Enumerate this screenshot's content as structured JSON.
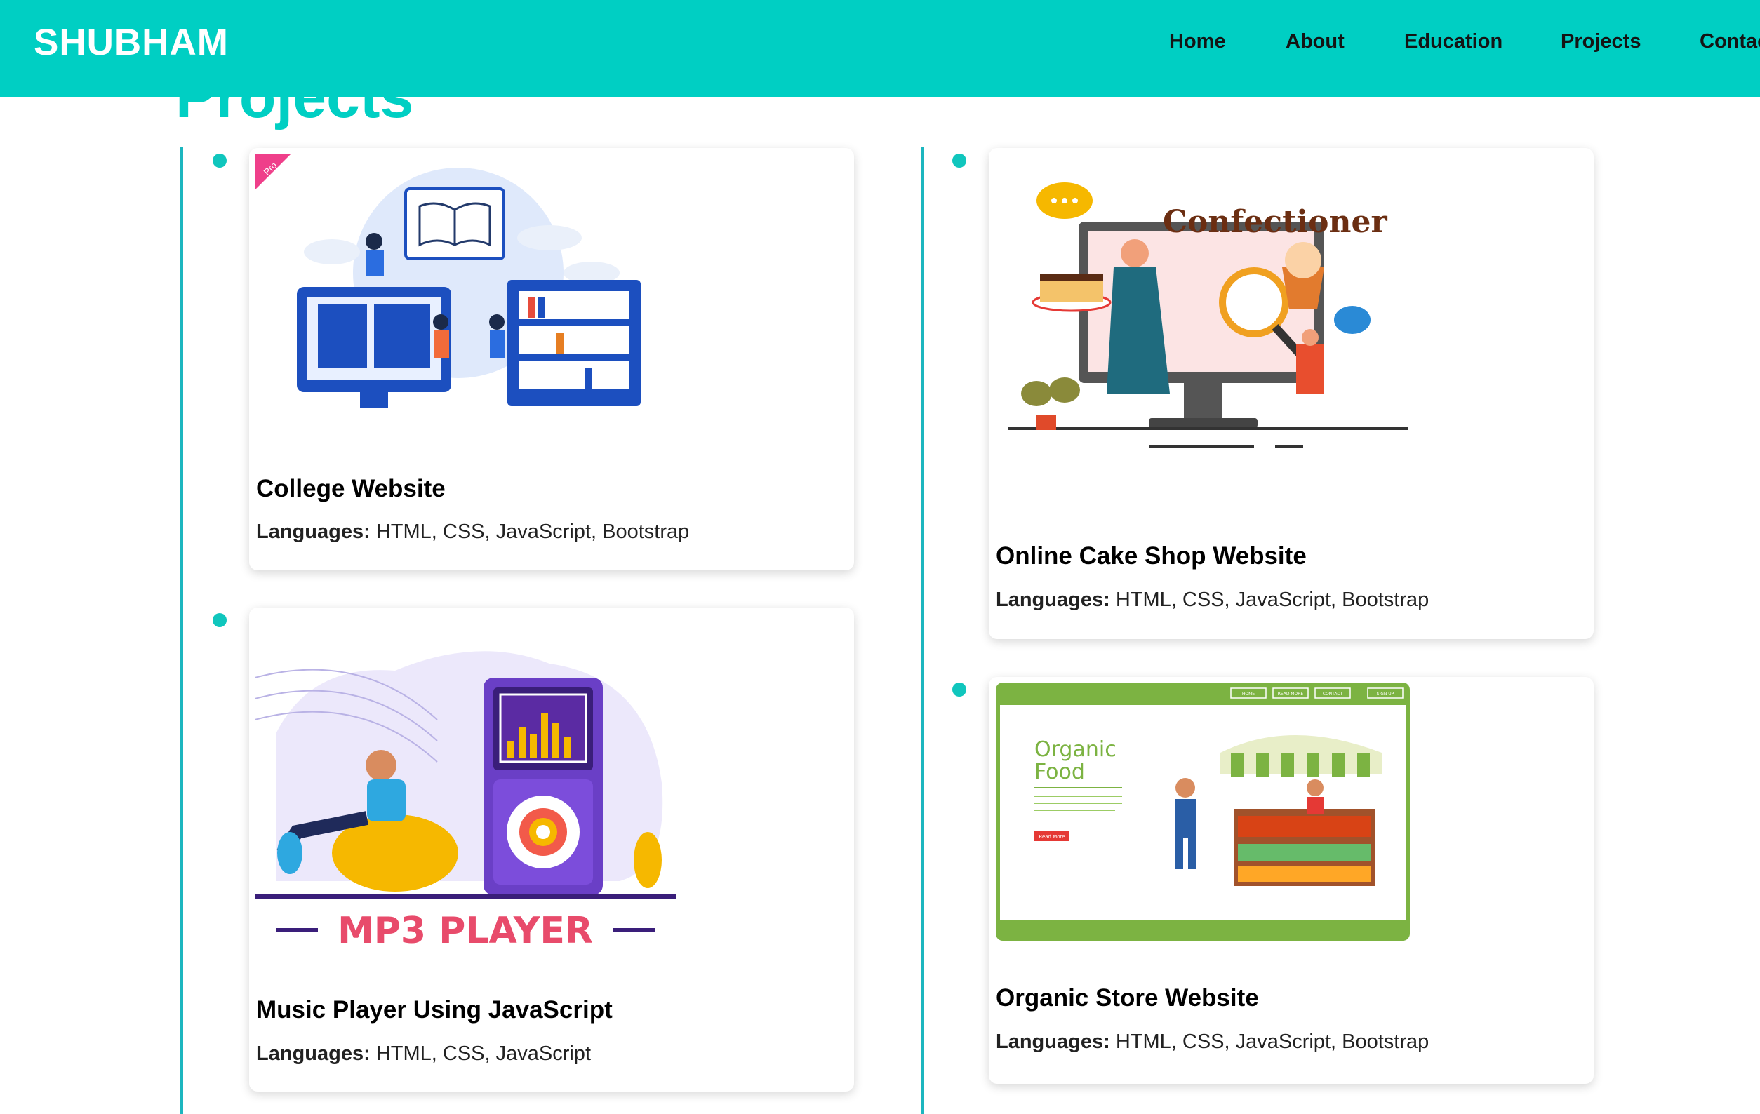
{
  "navbar": {
    "brand": "SHUBHAM",
    "links": [
      "Home",
      "About",
      "Education",
      "Projects",
      "Contac"
    ]
  },
  "section": {
    "title": "Projects"
  },
  "projects": [
    {
      "title": "College Website",
      "languages_label": "Languages:",
      "languages": "HTML, CSS, JavaScript, Bootstrap",
      "badge": "Pro",
      "image": "college-illustration"
    },
    {
      "title": "Online Cake Shop Website",
      "languages_label": "Languages:",
      "languages": "HTML, CSS, JavaScript, Bootstrap",
      "image_text": "Confectioner",
      "image": "confectioner-illustration"
    },
    {
      "title": "Music Player Using JavaScript",
      "languages_label": "Languages:",
      "languages": "HTML, CSS, JavaScript",
      "image_text": "MP3 PLAYER",
      "image": "mp3-player-illustration"
    },
    {
      "title": "Organic Store Website",
      "languages_label": "Languages:",
      "languages": "HTML, CSS, JavaScript, Bootstrap",
      "image_text": "Organic Food",
      "image_button": "Read More",
      "image_nav": [
        "HOME",
        "READ MORE",
        "CONTACT",
        "SIGN UP"
      ],
      "image": "organic-market-illustration"
    }
  ],
  "colors": {
    "accent": "#00cfc3",
    "timeline": "#1cb6bf",
    "organic_green": "#7cb342"
  }
}
